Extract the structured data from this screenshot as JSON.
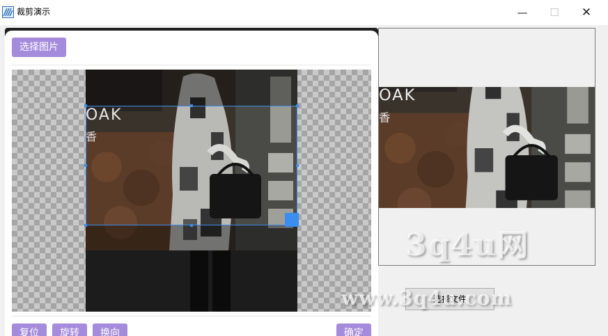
{
  "window": {
    "title": "裁剪演示",
    "minimize": "—",
    "maximize": "☐",
    "close": "✕"
  },
  "toolbar": {
    "select_image_label": "选择图片"
  },
  "photo": {
    "overlay_text_1": "OAK",
    "overlay_text_2": "香"
  },
  "actions": {
    "reset_label": "复位",
    "rotate_label": "旋转",
    "flip_label": "换向",
    "confirm_label": "确定"
  },
  "preview": {
    "select_file_label": "选择文件"
  },
  "watermark": {
    "line1": "3q4u网",
    "line2": "www.3q4u.com"
  },
  "colors": {
    "accent_purple": "#a58bdc",
    "crop_blue": "#3b8ef0"
  }
}
